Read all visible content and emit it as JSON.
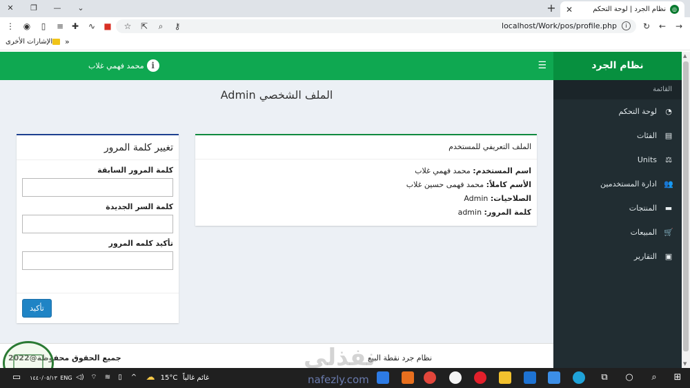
{
  "browser": {
    "tab_title": "نظام الجرد | لوحة التحكم",
    "url": "localhost/Work/pos/profile.php",
    "bookmarks_folder": "الإشارات الأخرى",
    "bookmarks_more": "»"
  },
  "header": {
    "user_name": "محمد فهمي غلاب"
  },
  "sidebar": {
    "brand": "نظام الجرد",
    "menu_header": "القائمة",
    "items": [
      {
        "label": "لوحة التحكم",
        "icon": "dashboard-icon"
      },
      {
        "label": "الفئات",
        "icon": "list-icon"
      },
      {
        "label": "Units",
        "icon": "balance-scale-icon"
      },
      {
        "label": "ادارة المستخدمين",
        "icon": "users-icon"
      },
      {
        "label": "المنتجات",
        "icon": "box-icon"
      },
      {
        "label": "المبيعات",
        "icon": "cart-icon"
      },
      {
        "label": "التقارير",
        "icon": "report-icon"
      }
    ]
  },
  "main": {
    "page_title": "الملف الشخصي Admin",
    "profile": {
      "heading": "الملف التعريفي للمستخدم",
      "rows": [
        {
          "label": "اسم المستخدم:",
          "value": "محمد فهمي غلاب"
        },
        {
          "label": "الأسم كاملاً:",
          "value": "محمد فهمى حسين غلاب"
        },
        {
          "label": "الصلاحيات:",
          "value": "Admin"
        },
        {
          "label": "كلمة المرور:",
          "value": "admin"
        }
      ]
    },
    "password": {
      "heading": "تغيير كلمة المرور",
      "old_label": "كلمة المرور السابقة",
      "new_label": "كلمة السر الجديدة",
      "confirm_label": "تأكيد كلمه المرور",
      "submit": "تأكيد"
    }
  },
  "footer": {
    "system_name": "نظام جرد نقطة البيع",
    "rights": "جميع الحقوق محفوظة@2022"
  },
  "watermark": {
    "text": "نفذلي",
    "url": "nafezly.com"
  },
  "taskbar": {
    "date": "١٤٤٠/٠٥/١٣",
    "lang": "ENG",
    "temperature": "15°C",
    "weather": "غائم غالباً"
  },
  "colors": {
    "header_green": "#0fa851",
    "brand_green": "#07903f",
    "sidebar_dark": "#212d32",
    "content_bg": "#ecf0f5",
    "button_blue": "#1f84c5"
  }
}
